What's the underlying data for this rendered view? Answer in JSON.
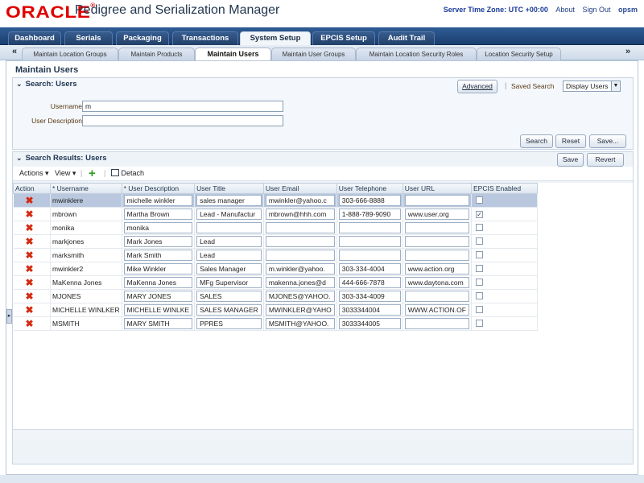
{
  "header": {
    "logo": "ORACLE",
    "app_title": "Pedigree and Serialization Manager",
    "server_time": "Server Time Zone: UTC +00:00",
    "about": "About",
    "sign_out": "Sign Out",
    "user": "opsm"
  },
  "tabs": [
    "Dashboard",
    "Serials",
    "Packaging",
    "Transactions",
    "System Setup",
    "EPCIS Setup",
    "Audit Trail"
  ],
  "subtabs": [
    "Maintain Location Groups",
    "Maintain Products",
    "Maintain Users",
    "Maintain User Groups",
    "Maintain Location Security Roles",
    "Location Security Setup"
  ],
  "page_title": "Maintain Users",
  "search": {
    "title": "Search: Users",
    "advanced": "Advanced",
    "saved_search_label": "Saved Search",
    "saved_search_value": "Display Users",
    "username_label": "Username",
    "username_value": "m",
    "description_label": "User Description",
    "description_value": "",
    "search_btn": "Search",
    "reset_btn": "Reset",
    "save_btn": "Save..."
  },
  "results": {
    "title": "Search Results: Users",
    "save_btn": "Save",
    "revert_btn": "Revert",
    "actions": "Actions",
    "view": "View",
    "detach": "Detach",
    "columns": [
      "Action",
      "* Username",
      "* User Description",
      "User Title",
      "User Email",
      "User Telephone",
      "User URL",
      "EPCIS Enabled"
    ],
    "rows": [
      {
        "username": "mwinklere",
        "description": "michelle winkler",
        "title": "sales manager",
        "email": "mwinkler@yahoo.c",
        "phone": "303-666-8888",
        "url": "",
        "epcis": false
      },
      {
        "username": "mbrown",
        "description": "Martha Brown",
        "title": "Lead - Manufactur",
        "email": "mbrown@hhh.com",
        "phone": "1-888-789-9090",
        "url": "www.user.org",
        "epcis": true
      },
      {
        "username": "monika",
        "description": "monika",
        "title": "",
        "email": "",
        "phone": "",
        "url": "",
        "epcis": false
      },
      {
        "username": "markjones",
        "description": "Mark Jones",
        "title": "Lead",
        "email": "",
        "phone": "",
        "url": "",
        "epcis": false
      },
      {
        "username": "marksmith",
        "description": "Mark Smith",
        "title": "Lead",
        "email": "",
        "phone": "",
        "url": "",
        "epcis": false
      },
      {
        "username": "mwinkler2",
        "description": "Mike Winkler",
        "title": "Sales Manager",
        "email": "m.winkler@yahoo.",
        "phone": "303-334-4004",
        "url": "www.action.org",
        "epcis": false
      },
      {
        "username": "MaKenna Jones",
        "description": "MaKenna Jones",
        "title": "MFg Supervisor",
        "email": "makenna.jones@d",
        "phone": "444-666-7878",
        "url": "www.daytona.com",
        "epcis": false
      },
      {
        "username": "MJONES",
        "description": "MARY JONES",
        "title": "SALES",
        "email": "MJONES@YAHOO.",
        "phone": "303-334-4009",
        "url": "",
        "epcis": false
      },
      {
        "username": "MICHELLE WINLKER",
        "description": "MICHELLE WINLKE",
        "title": "SALES MANAGER",
        "email": "MWINKLER@YAHO",
        "phone": "3033344004",
        "url": "WWW.ACTION.OF",
        "epcis": false
      },
      {
        "username": "MSMITH",
        "description": "MARY SMITH",
        "title": "PPRES",
        "email": "MSMITH@YAHOO.",
        "phone": "3033344005",
        "url": "",
        "epcis": false
      }
    ]
  }
}
